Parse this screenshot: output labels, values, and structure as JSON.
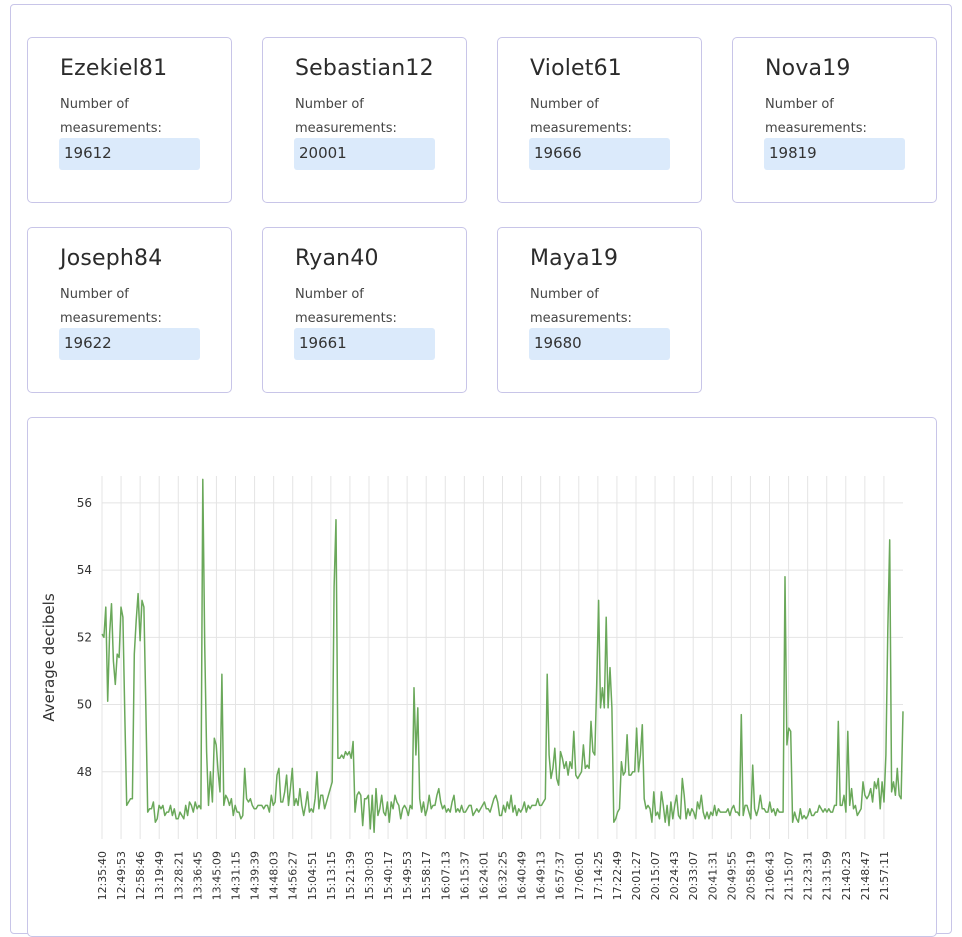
{
  "cards": [
    {
      "name": "Ezekiel81",
      "label": "Number of measurements:",
      "value": "19612"
    },
    {
      "name": "Sebastian12",
      "label": "Number of measurements:",
      "value": "20001"
    },
    {
      "name": "Violet61",
      "label": "Number of measurements:",
      "value": "19666"
    },
    {
      "name": "Nova19",
      "label": "Number of measurements:",
      "value": "19819"
    },
    {
      "name": "Joseph84",
      "label": "Number of measurements:",
      "value": "19622"
    },
    {
      "name": "Ryan40",
      "label": "Number of measurements:",
      "value": "19661"
    },
    {
      "name": "Maya19",
      "label": "Number of measurements:",
      "value": "19680"
    }
  ],
  "chart_data": {
    "type": "line",
    "ylabel": "Average decibels",
    "ylim": [
      46,
      56.8
    ],
    "yticks": [
      48,
      50,
      52,
      54,
      56
    ],
    "grid": true,
    "line_color": "#6aa85a",
    "xticks": [
      "12:35:40",
      "12:49:53",
      "12:58:46",
      "13:19:49",
      "13:28:21",
      "13:36:45",
      "13:45:09",
      "14:31:15",
      "14:39:39",
      "14:48:03",
      "14:56:27",
      "15:04:51",
      "15:13:15",
      "15:21:39",
      "15:30:03",
      "15:40:17",
      "15:49:53",
      "15:58:17",
      "16:07:13",
      "16:15:37",
      "16:24:01",
      "16:32:25",
      "16:40:49",
      "16:49:13",
      "16:57:37",
      "17:06:01",
      "17:14:25",
      "17:22:49",
      "20:01:27",
      "20:15:07",
      "20:24:43",
      "20:33:07",
      "20:41:31",
      "20:49:55",
      "20:58:19",
      "21:06:43",
      "21:15:07",
      "21:23:31",
      "21:31:59",
      "21:40:23",
      "21:48:47",
      "21:57:11"
    ],
    "values": [
      52.1,
      52.0,
      52.9,
      50.1,
      52.1,
      53.0,
      51.3,
      50.6,
      51.5,
      51.4,
      52.9,
      52.6,
      49.7,
      47.0,
      47.1,
      47.2,
      47.2,
      51.5,
      52.5,
      53.3,
      51.9,
      53.1,
      52.9,
      50.0,
      46.8,
      46.9,
      46.9,
      47.1,
      46.5,
      46.6,
      47.0,
      46.9,
      47.0,
      46.7,
      46.8,
      46.8,
      47.0,
      46.7,
      46.9,
      46.6,
      46.6,
      46.8,
      46.7,
      46.6,
      47.0,
      46.7,
      47.1,
      47.0,
      46.8,
      47.1,
      46.9,
      47.0,
      46.9,
      56.7,
      51.8,
      48.6,
      47.0,
      48.0,
      47.1,
      49.0,
      48.8,
      48.0,
      47.4,
      50.9,
      47.0,
      47.3,
      47.2,
      47.0,
      47.2,
      46.7,
      47.0,
      46.8,
      46.8,
      46.6,
      46.7,
      48.1,
      47.2,
      47.1,
      47.2,
      47.0,
      46.9,
      46.9,
      47.0,
      47.0,
      47.0,
      46.9,
      47.0,
      47.0,
      46.8,
      47.3,
      47.0,
      47.1,
      47.9,
      48.1,
      47.1,
      47.1,
      47.4,
      47.9,
      47.0,
      47.5,
      48.1,
      47.0,
      47.2,
      47.0,
      47.5,
      47.0,
      46.7,
      47.0,
      47.4,
      46.8,
      46.9,
      46.8,
      47.2,
      48.0,
      46.9,
      47.3,
      47.3,
      46.9,
      47.1,
      47.3,
      47.5,
      47.7,
      53.5,
      55.5,
      48.4,
      48.4,
      48.5,
      48.4,
      48.6,
      48.5,
      48.6,
      48.4,
      48.9,
      46.8,
      47.3,
      47.4,
      47.3,
      46.4,
      47.2,
      47.2,
      47.3,
      46.3,
      47.3,
      46.2,
      47.5,
      46.7,
      46.9,
      47.3,
      46.8,
      46.7,
      47.1,
      46.5,
      47.1,
      46.9,
      47.3,
      47.1,
      47.0,
      46.6,
      46.9,
      47.0,
      46.9,
      46.7,
      47.0,
      46.9,
      50.5,
      48.5,
      49.9,
      47.2,
      46.8,
      47.1,
      46.7,
      46.9,
      47.3,
      46.9,
      47.0,
      47.0,
      47.3,
      47.5,
      47.1,
      46.9,
      47.0,
      46.8,
      46.9,
      46.8,
      47.1,
      47.3,
      46.8,
      46.9,
      46.8,
      47.0,
      46.8,
      46.8,
      46.9,
      47.0,
      47.0,
      46.7,
      46.8,
      46.9,
      46.8,
      46.9,
      47.0,
      47.1,
      46.9,
      46.9,
      46.8,
      47.0,
      47.2,
      47.3,
      47.1,
      46.7,
      46.7,
      47.0,
      46.8,
      47.1,
      46.9,
      47.3,
      46.8,
      47.0,
      46.7,
      46.9,
      46.8,
      46.9,
      47.1,
      46.8,
      47.0,
      46.9,
      47.0,
      47.0,
      47.0,
      47.2,
      47.0,
      47.0,
      47.1,
      47.2,
      50.9,
      48.5,
      47.8,
      48.1,
      48.7,
      47.8,
      47.6,
      48.6,
      48.4,
      48.1,
      48.3,
      47.9,
      48.3,
      48.1,
      49.2,
      47.9,
      47.8,
      47.9,
      48.0,
      48.8,
      48.1,
      48.2,
      48.1,
      49.5,
      48.6,
      48.5,
      50.6,
      53.1,
      49.9,
      50.5,
      49.9,
      52.6,
      49.9,
      51.1,
      49.9,
      46.5,
      46.6,
      46.8,
      46.9,
      48.3,
      47.9,
      48.0,
      49.1,
      47.9,
      47.9,
      48.0,
      48.0,
      49.3,
      48.0,
      48.5,
      49.4,
      47.2,
      46.9,
      47.0,
      46.9,
      46.5,
      47.4,
      46.7,
      46.8,
      46.6,
      47.4,
      47.0,
      46.5,
      47.0,
      46.4,
      47.1,
      46.6,
      47.0,
      47.3,
      46.7,
      46.6,
      47.8,
      47.3,
      46.6,
      46.9,
      46.7,
      46.9,
      46.8,
      46.6,
      47.1,
      46.9,
      47.3,
      46.8,
      46.6,
      46.8,
      46.6,
      46.8,
      46.7,
      47.0,
      46.7,
      46.9,
      46.8,
      46.8,
      46.8,
      46.8,
      46.9,
      46.7,
      46.9,
      47.0,
      46.8,
      46.8,
      46.7,
      49.7,
      46.7,
      47.0,
      47.0,
      46.8,
      46.6,
      48.2,
      46.9,
      46.7,
      46.9,
      47.3,
      46.9,
      46.9,
      46.8,
      46.8,
      47.1,
      46.8,
      46.9,
      46.7,
      46.9,
      46.8,
      46.8,
      46.8,
      53.8,
      48.8,
      49.3,
      49.2,
      46.5,
      46.8,
      46.6,
      46.5,
      46.9,
      46.6,
      46.7,
      46.6,
      46.7,
      46.9,
      46.7,
      46.7,
      46.8,
      46.8,
      47.0,
      46.9,
      46.8,
      46.9,
      46.8,
      46.9,
      46.8,
      46.8,
      47.0,
      47.0,
      49.5,
      47.0,
      47.0,
      47.3,
      46.8,
      49.2,
      47.0,
      47.5,
      46.9,
      47.0,
      46.7,
      46.8,
      46.9,
      47.7,
      47.3,
      47.2,
      47.3,
      47.5,
      47.1,
      47.7,
      47.5,
      47.8,
      46.9,
      47.7,
      47.1,
      48.5,
      52.2,
      54.9,
      47.4,
      47.7,
      47.3,
      48.1,
      47.3,
      47.2,
      49.8
    ]
  }
}
